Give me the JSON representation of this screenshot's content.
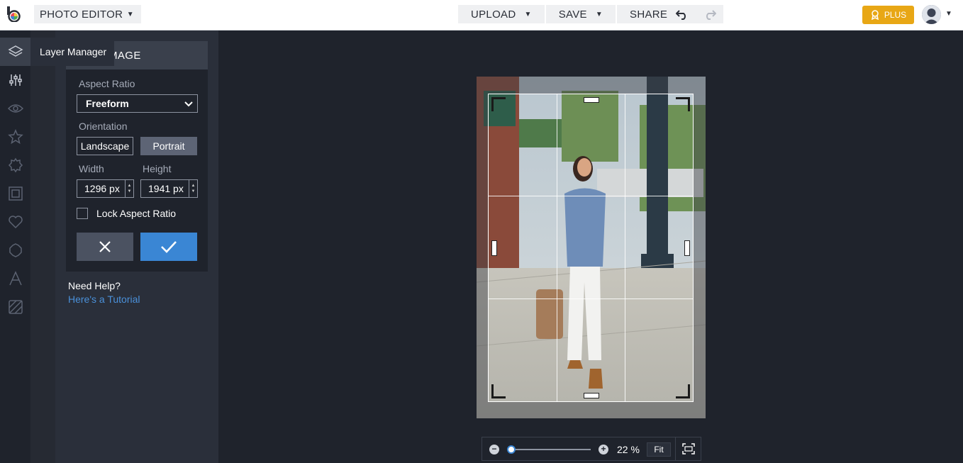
{
  "topbar": {
    "app_menu_label": "PHOTO EDITOR",
    "actions": [
      {
        "label": "UPLOAD"
      },
      {
        "label": "SAVE"
      },
      {
        "label": "SHARE"
      }
    ],
    "plus_label": "PLUS"
  },
  "rail": {
    "icons": [
      "layers-icon",
      "sliders-icon",
      "eye-icon",
      "star-icon",
      "badge-icon",
      "frame-icon",
      "heart-icon",
      "shape-icon",
      "text-icon",
      "texture-icon"
    ],
    "tooltip": "Layer Manager"
  },
  "panel": {
    "header_title": "MAGE",
    "aspect_label": "Aspect Ratio",
    "aspect_value": "Freeform",
    "orientation_label": "Orientation",
    "landscape_label": "Landscape",
    "portrait_label": "Portrait",
    "width_label": "Width",
    "height_label": "Height",
    "width_value": "1296 px",
    "height_value": "1941 px",
    "lock_label": "Lock Aspect Ratio",
    "help_title": "Need Help?",
    "help_link": "Here's a Tutorial"
  },
  "zoom": {
    "value": "22 %",
    "fit_label": "Fit",
    "level_fraction": 0.03
  },
  "colors": {
    "accent": "#3a86d4",
    "plus": "#e8a715",
    "background": "#1f232c"
  }
}
